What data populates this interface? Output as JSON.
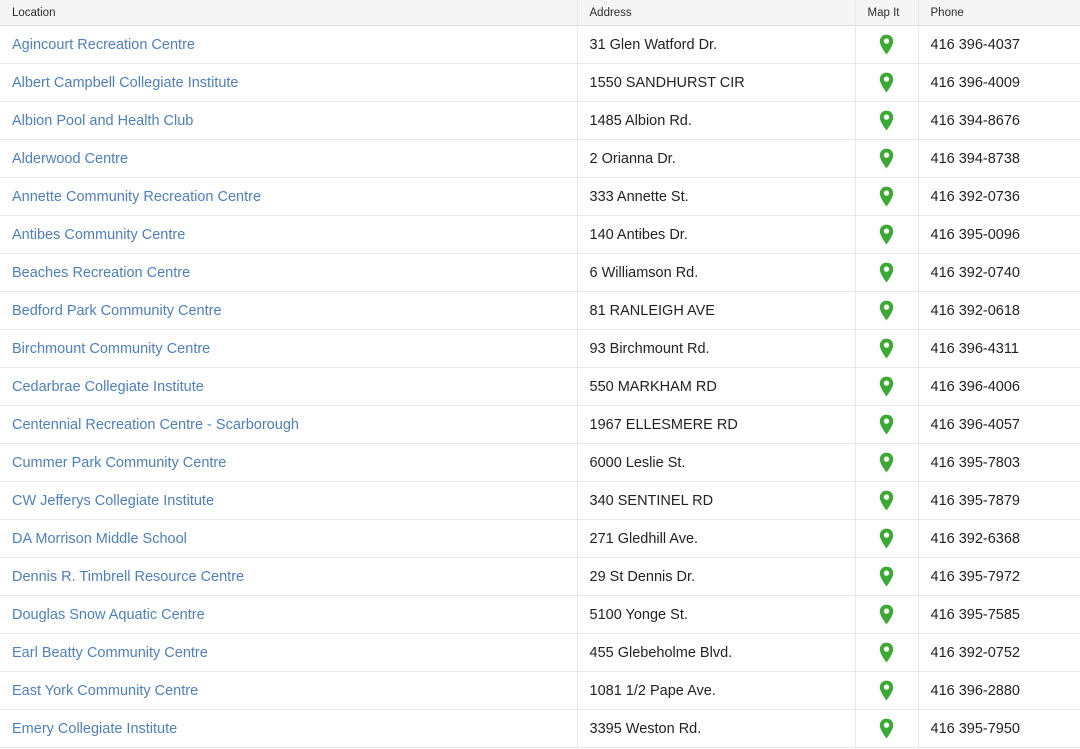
{
  "table": {
    "columns": [
      {
        "key": "location",
        "label": "Location"
      },
      {
        "key": "address",
        "label": "Address"
      },
      {
        "key": "mapit",
        "label": "Map It"
      },
      {
        "key": "phone",
        "label": "Phone"
      }
    ],
    "map_icon": "map-pin-icon",
    "colors": {
      "link": "#4e7fbd",
      "pin": "#3aaa35",
      "header_bg": "#f5f5f5",
      "row_border": "#e8e8e8",
      "text": "#2b2b2b"
    },
    "rows": [
      {
        "location": "Agincourt Recreation Centre",
        "address": "31 Glen Watford Dr.",
        "phone": "416 396-4037"
      },
      {
        "location": "Albert Campbell Collegiate Institute",
        "address": "1550 SANDHURST CIR",
        "phone": "416 396-4009"
      },
      {
        "location": "Albion Pool and Health Club",
        "address": "1485 Albion Rd.",
        "phone": "416 394-8676"
      },
      {
        "location": "Alderwood Centre",
        "address": "2 Orianna Dr.",
        "phone": "416 394-8738"
      },
      {
        "location": "Annette Community Recreation Centre",
        "address": "333 Annette St.",
        "phone": "416 392-0736"
      },
      {
        "location": "Antibes Community Centre",
        "address": "140 Antibes Dr.",
        "phone": "416 395-0096"
      },
      {
        "location": "Beaches Recreation Centre",
        "address": "6 Williamson Rd.",
        "phone": "416 392-0740"
      },
      {
        "location": "Bedford Park Community Centre",
        "address": "81 RANLEIGH AVE",
        "phone": "416 392-0618"
      },
      {
        "location": "Birchmount Community Centre",
        "address": "93 Birchmount Rd.",
        "phone": "416 396-4311"
      },
      {
        "location": "Cedarbrae Collegiate Institute",
        "address": "550 MARKHAM RD",
        "phone": "416 396-4006"
      },
      {
        "location": "Centennial Recreation Centre - Scarborough",
        "address": "1967 ELLESMERE RD",
        "phone": "416 396-4057"
      },
      {
        "location": "Cummer Park Community Centre",
        "address": "6000 Leslie St.",
        "phone": "416 395-7803"
      },
      {
        "location": "CW Jefferys Collegiate Institute",
        "address": "340 SENTINEL RD",
        "phone": "416 395-7879"
      },
      {
        "location": "DA Morrison Middle School",
        "address": "271 Gledhill Ave.",
        "phone": "416 392-6368"
      },
      {
        "location": "Dennis R. Timbrell Resource Centre",
        "address": "29 St Dennis Dr.",
        "phone": "416 395-7972"
      },
      {
        "location": "Douglas Snow Aquatic Centre",
        "address": "5100 Yonge St.",
        "phone": "416 395-7585"
      },
      {
        "location": "Earl Beatty Community Centre",
        "address": "455 Glebeholme Blvd.",
        "phone": "416 392-0752"
      },
      {
        "location": "East York Community Centre",
        "address": "1081 1/2 Pape Ave.",
        "phone": "416 396-2880"
      },
      {
        "location": "Emery Collegiate Institute",
        "address": "3395 Weston Rd.",
        "phone": "416 395-7950"
      }
    ]
  }
}
